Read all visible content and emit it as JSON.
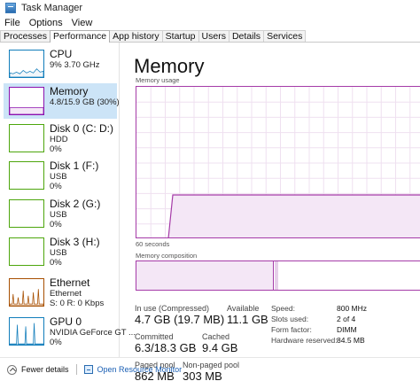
{
  "window": {
    "title": "Task Manager"
  },
  "menu": [
    "File",
    "Options",
    "View"
  ],
  "tabs": [
    "Processes",
    "Performance",
    "App history",
    "Startup",
    "Users",
    "Details",
    "Services"
  ],
  "active_tab": "Performance",
  "sidebar": [
    {
      "title": "CPU",
      "lines": [
        "9%  3.70 GHz"
      ],
      "color": "#117dbb"
    },
    {
      "title": "Memory",
      "lines": [
        "4.8/15.9 GB (30%)"
      ],
      "color": "#8b12ae",
      "selected": true
    },
    {
      "title": "Disk 0 (C: D:)",
      "lines": [
        "HDD",
        "0%"
      ],
      "color": "#4da60c"
    },
    {
      "title": "Disk 1 (F:)",
      "lines": [
        "USB",
        "0%"
      ],
      "color": "#4da60c"
    },
    {
      "title": "Disk 2 (G:)",
      "lines": [
        "USB",
        "0%"
      ],
      "color": "#4da60c"
    },
    {
      "title": "Disk 3 (H:)",
      "lines": [
        "USB",
        "0%"
      ],
      "color": "#4da60c"
    },
    {
      "title": "Ethernet",
      "lines": [
        "Ethernet",
        "S: 0 R: 0 Kbps"
      ],
      "color": "#a74f01"
    },
    {
      "title": "GPU 0",
      "lines": [
        "NVIDIA GeForce GT ...",
        "0%"
      ],
      "color": "#117dbb"
    }
  ],
  "main": {
    "title": "Memory",
    "usage_label": "Memory usage",
    "time_label": "60 seconds",
    "composition_label": "Memory composition",
    "usage_fraction": 0.3
  },
  "stats": {
    "in_use_label": "In use (Compressed)",
    "in_use_value": "4.7 GB (19.7 MB)",
    "available_label": "Available",
    "available_value": "11.1 GB",
    "committed_label": "Committed",
    "committed_value": "6.3/18.3 GB",
    "cached_label": "Cached",
    "cached_value": "9.4 GB",
    "paged_label": "Paged pool",
    "paged_value": "862 MB",
    "nonpaged_label": "Non-paged pool",
    "nonpaged_value": "303 MB"
  },
  "specs": [
    {
      "label": "Speed:",
      "value": "800 MHz"
    },
    {
      "label": "Slots used:",
      "value": "2 of 4"
    },
    {
      "label": "Form factor:",
      "value": "DIMM"
    },
    {
      "label": "Hardware reserved:",
      "value": "84.5 MB"
    }
  ],
  "footer": {
    "fewer_details": "Fewer details",
    "open_monitor": "Open Resource Monitor"
  },
  "colors": {
    "memory": "#a53ba8",
    "memory_fill": "#f4e7f6",
    "selected_bg": "#cce4f7",
    "link": "#1a5fb4"
  }
}
